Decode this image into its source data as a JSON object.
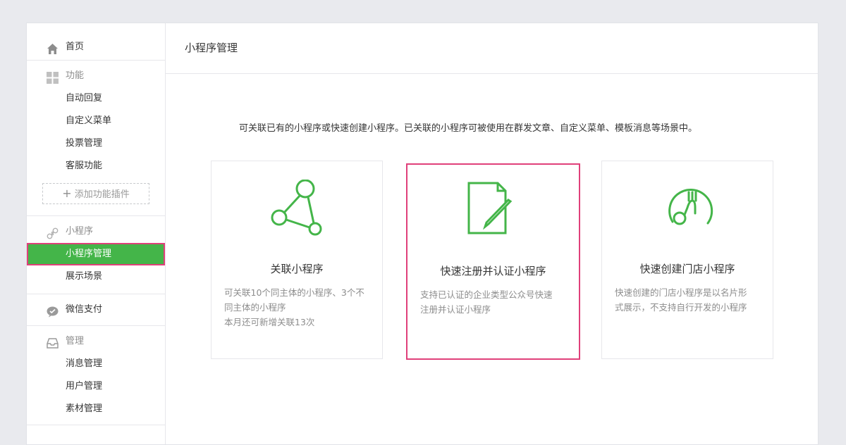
{
  "sidebar": {
    "home": {
      "label": "首页",
      "icon": "home-icon"
    },
    "features": {
      "label": "功能",
      "icon": "grid-icon",
      "items": [
        "自动回复",
        "自定义菜单",
        "投票管理",
        "客服功能"
      ],
      "add_plugin": "添加功能插件"
    },
    "miniprogram": {
      "label": "小程序",
      "icon": "miniprogram-icon",
      "items": [
        "小程序管理",
        "展示场景"
      ],
      "active_index": 0
    },
    "pay": {
      "label": "微信支付",
      "icon": "wechat-pay-icon"
    },
    "manage": {
      "label": "管理",
      "icon": "inbox-icon",
      "items": [
        "消息管理",
        "用户管理",
        "素材管理"
      ]
    }
  },
  "main": {
    "title": "小程序管理",
    "intro": "可关联已有的小程序或快速创建小程序。已关联的小程序可被使用在群发文章、自定义菜单、模板消息等场景中。",
    "cards": [
      {
        "title": "关联小程序",
        "icon": "link-nodes-icon",
        "desc": [
          "可关联10个同主体的小程序、3个不",
          "同主体的小程序",
          "本月还可新增关联13次"
        ]
      },
      {
        "title": "快速注册并认证小程序",
        "icon": "document-edit-icon",
        "desc": [
          "支持已认证的企业类型公众号快速",
          "注册并认证小程序"
        ]
      },
      {
        "title": "快速创建门店小程序",
        "icon": "store-fork-icon",
        "desc": [
          "快速创建的门店小程序是以名片形",
          "式展示，不支持自行开发的小程序"
        ]
      }
    ]
  },
  "colors": {
    "accent": "#44b549",
    "highlight": "#e0407a"
  }
}
